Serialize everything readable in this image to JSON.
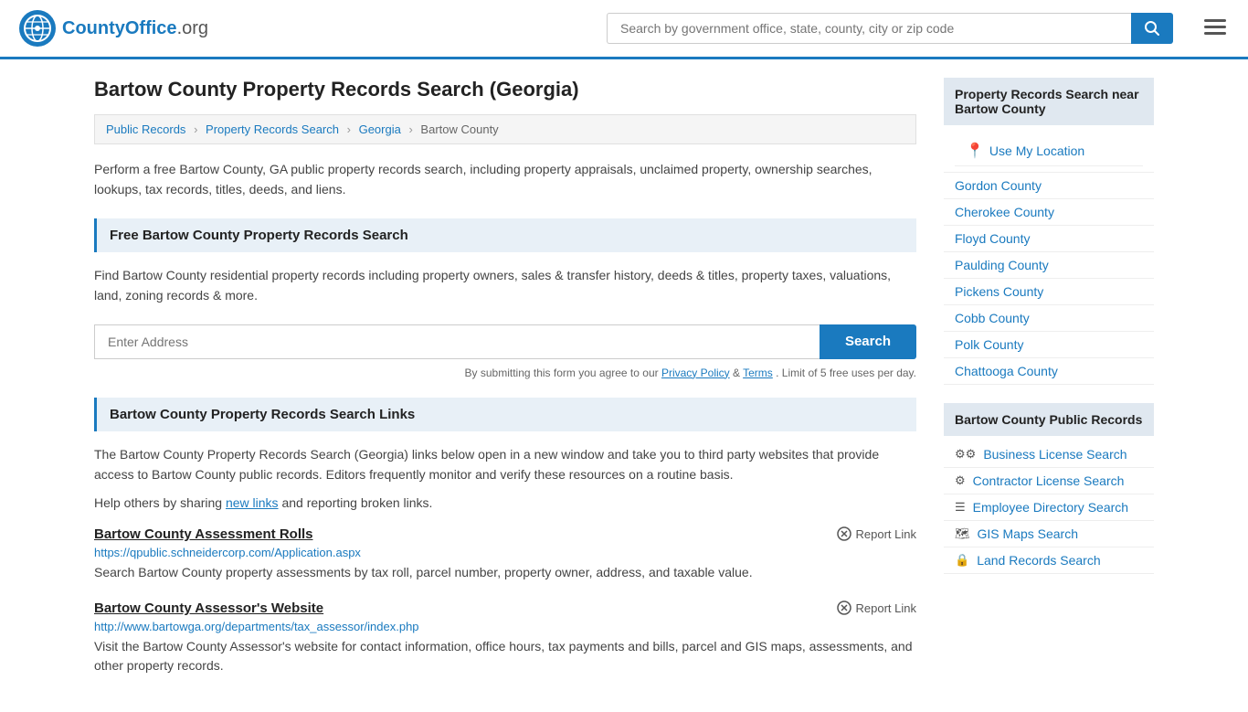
{
  "header": {
    "logo_text": "CountyOffice",
    "logo_org": ".org",
    "search_placeholder": "Search by government office, state, county, city or zip code",
    "search_btn_label": "Search"
  },
  "breadcrumb": {
    "items": [
      "Public Records",
      "Property Records Search",
      "Georgia",
      "Bartow County"
    ]
  },
  "main": {
    "page_title": "Bartow County Property Records Search (Georgia)",
    "description": "Perform a free Bartow County, GA public property records search, including property appraisals, unclaimed property, ownership searches, lookups, tax records, titles, deeds, and liens.",
    "free_search_header": "Free Bartow County Property Records Search",
    "free_search_description": "Find Bartow County residential property records including property owners, sales & transfer history, deeds & titles, property taxes, valuations, land, zoning records & more.",
    "address_placeholder": "Enter Address",
    "search_btn_label": "Search",
    "form_disclaimer_prefix": "By submitting this form you agree to our",
    "privacy_label": "Privacy Policy",
    "and": "&",
    "terms_label": "Terms",
    "form_disclaimer_suffix": ". Limit of 5 free uses per day.",
    "links_header": "Bartow County Property Records Search Links",
    "links_description": "The Bartow County Property Records Search (Georgia) links below open in a new window and take you to third party websites that provide access to Bartow County public records. Editors frequently monitor and verify these resources on a routine basis.",
    "share_prefix": "Help others by sharing",
    "share_link_label": "new links",
    "share_suffix": "and reporting broken links.",
    "link_items": [
      {
        "title": "Bartow County Assessment Rolls",
        "url": "https://qpublic.schneidercorp.com/Application.aspx",
        "description": "Search Bartow County property assessments by tax roll, parcel number, property owner, address, and taxable value.",
        "report_label": "Report Link"
      },
      {
        "title": "Bartow County Assessor's Website",
        "url": "http://www.bartowga.org/departments/tax_assessor/index.php",
        "description": "Visit the Bartow County Assessor's website for contact information, office hours, tax payments and bills, parcel and GIS maps, assessments, and other property records.",
        "report_label": "Report Link"
      }
    ]
  },
  "sidebar": {
    "nearby_title": "Property Records Search near Bartow County",
    "use_location_label": "Use My Location",
    "nearby_counties": [
      "Gordon County",
      "Cherokee County",
      "Floyd County",
      "Paulding County",
      "Pickens County",
      "Cobb County",
      "Polk County",
      "Chattooga County"
    ],
    "public_records_title": "Bartow County Public Records",
    "public_records_items": [
      {
        "icon": "⚙⚙",
        "label": "Business License Search"
      },
      {
        "icon": "⚙",
        "label": "Contractor License Search"
      },
      {
        "icon": "☰",
        "label": "Employee Directory Search"
      },
      {
        "icon": "🗺",
        "label": "GIS Maps Search"
      },
      {
        "icon": "🔒",
        "label": "Land Records Search"
      }
    ]
  }
}
